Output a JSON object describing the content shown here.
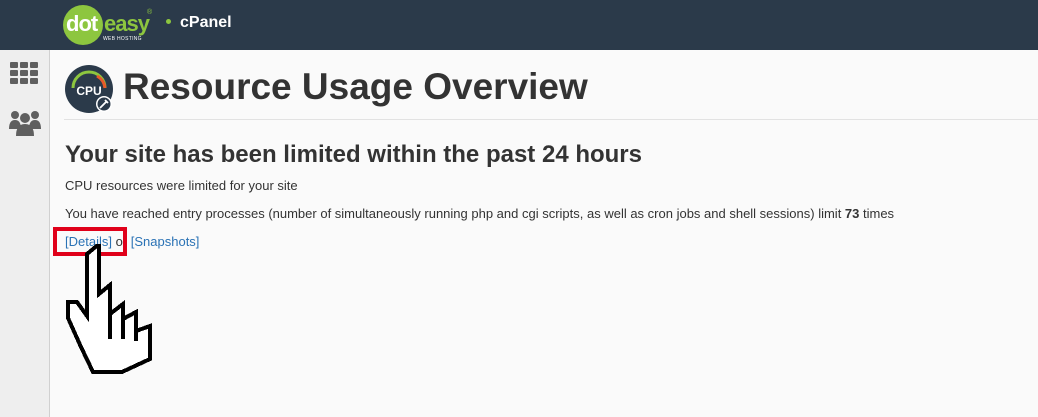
{
  "topbar": {
    "logo": {
      "part1": "dot",
      "part2": "easy",
      "trademark": "®",
      "subtitle": "WEB HOSTING"
    },
    "product": "cPanel",
    "colors": {
      "background": "#2b3a4a",
      "accent": "#8dc63f"
    }
  },
  "sidebar": {
    "icons": [
      "grid-icon",
      "users-icon"
    ]
  },
  "page": {
    "icon": "cpu-icon",
    "icon_label": "CPU",
    "title": "Resource Usage Overview"
  },
  "content": {
    "heading": "Your site has been limited within the past 24 hours",
    "cpu_message": "CPU resources were limited for your site",
    "entry_message_prefix": "You have reached entry processes (number of simultaneously running php and cgi scripts, as well as cron jobs and shell sessions) limit ",
    "entry_count": "73",
    "entry_message_suffix": " times",
    "details_link": "[Details]",
    "or_text": " or ",
    "snapshots_link": "[Snapshots]"
  },
  "annotations": {
    "highlight_color": "#e0001a",
    "pointer": "hand-cursor-icon"
  }
}
